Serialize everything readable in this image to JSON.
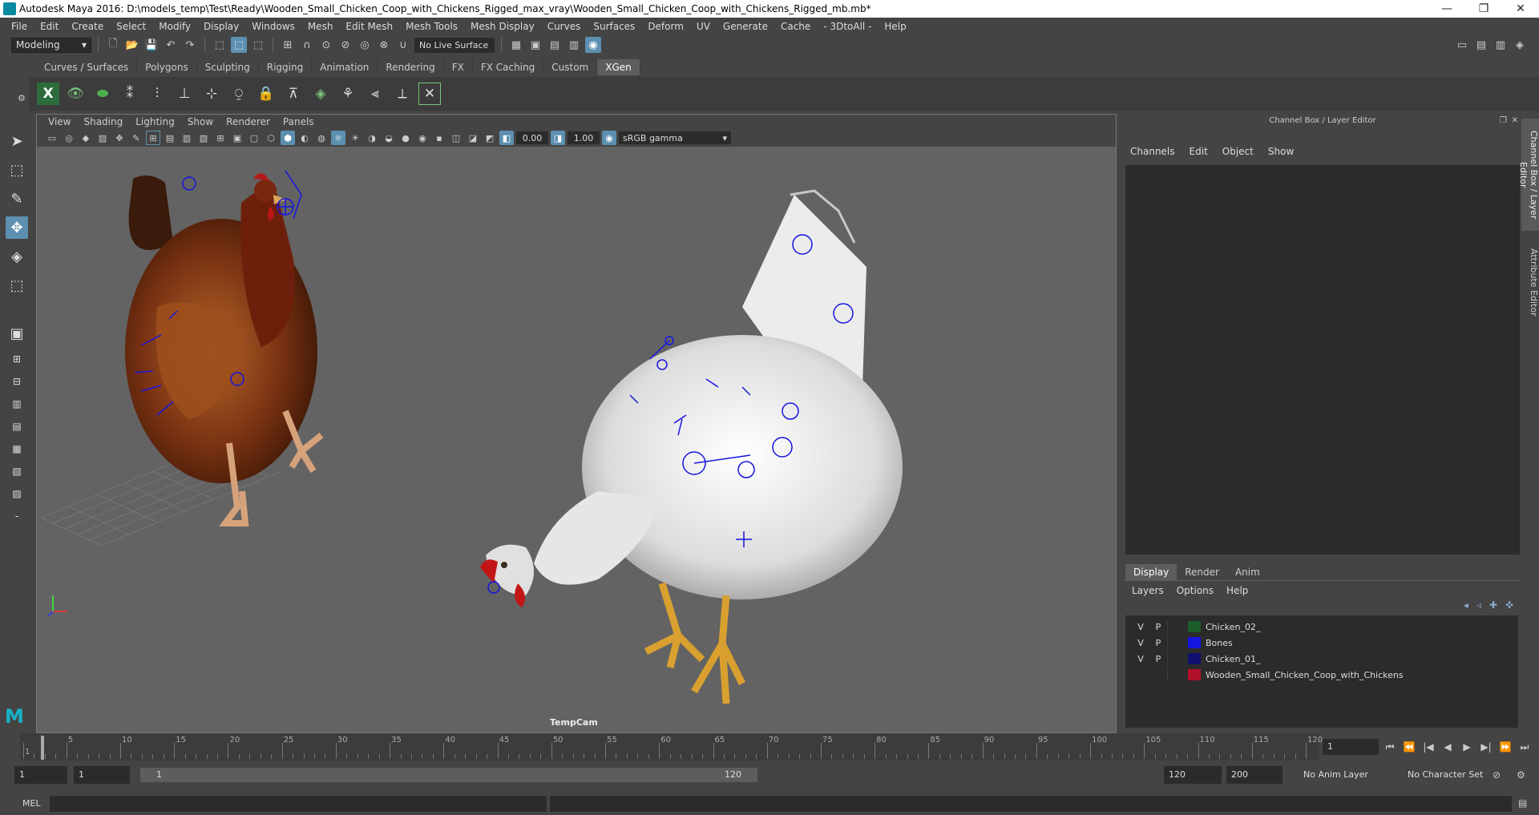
{
  "window": {
    "title": "Autodesk Maya 2016: D:\\models_temp\\Test\\Ready\\Wooden_Small_Chicken_Coop_with_Chickens_Rigged_max_vray\\Wooden_Small_Chicken_Coop_with_Chickens_Rigged_mb.mb*",
    "minimize": "—",
    "maximize": "❐",
    "close": "✕"
  },
  "menubar": [
    "File",
    "Edit",
    "Create",
    "Select",
    "Modify",
    "Display",
    "Windows",
    "Mesh",
    "Edit Mesh",
    "Mesh Tools",
    "Mesh Display",
    "Curves",
    "Surfaces",
    "Deform",
    "UV",
    "Generate",
    "Cache",
    "- 3DtoAll -",
    "Help"
  ],
  "statusline": {
    "mode": "Modeling",
    "live_surface": "No Live Surface"
  },
  "shelf": {
    "tabs": [
      "Curves / Surfaces",
      "Polygons",
      "Sculpting",
      "Rigging",
      "Animation",
      "Rendering",
      "FX",
      "FX Caching",
      "Custom",
      "XGen"
    ],
    "active_tab": "XGen"
  },
  "viewport": {
    "menu": [
      "View",
      "Shading",
      "Lighting",
      "Show",
      "Renderer",
      "Panels"
    ],
    "exposure": "0.00",
    "gamma": "1.00",
    "color_space": "sRGB gamma",
    "camera": "TempCam"
  },
  "channel_box": {
    "title": "Channel Box / Layer Editor",
    "menu": [
      "Channels",
      "Edit",
      "Object",
      "Show"
    ]
  },
  "side_tabs": [
    "Channel Box / Layer Editor",
    "Attribute Editor"
  ],
  "layer_editor": {
    "tabs": [
      "Display",
      "Render",
      "Anim"
    ],
    "active_tab": "Display",
    "menu": [
      "Layers",
      "Options",
      "Help"
    ],
    "layers": [
      {
        "v": "V",
        "p": "P",
        "name": "Chicken_02_",
        "color": "#1a5c2a"
      },
      {
        "v": "V",
        "p": "P",
        "name": "Bones",
        "color": "#1515e0"
      },
      {
        "v": "V",
        "p": "P",
        "name": "Chicken_01_",
        "color": "#101070"
      },
      {
        "v": "",
        "p": "",
        "name": "Wooden_Small_Chicken_Coop_with_Chickens",
        "color": "#b0102a"
      }
    ]
  },
  "timeline": {
    "ticks": [
      "1",
      "5",
      "10",
      "15",
      "20",
      "25",
      "30",
      "35",
      "40",
      "45",
      "50",
      "55",
      "60",
      "65",
      "70",
      "75",
      "80",
      "85",
      "90",
      "95",
      "100",
      "105",
      "110",
      "115",
      "120"
    ],
    "current_frame": "1"
  },
  "range": {
    "start": "1",
    "anim_start": "1",
    "inner_start": "1",
    "inner_end": "120",
    "end": "120",
    "anim_end": "200",
    "anim_layer": "No Anim Layer",
    "character_set": "No Character Set"
  },
  "command": {
    "label": "MEL"
  }
}
